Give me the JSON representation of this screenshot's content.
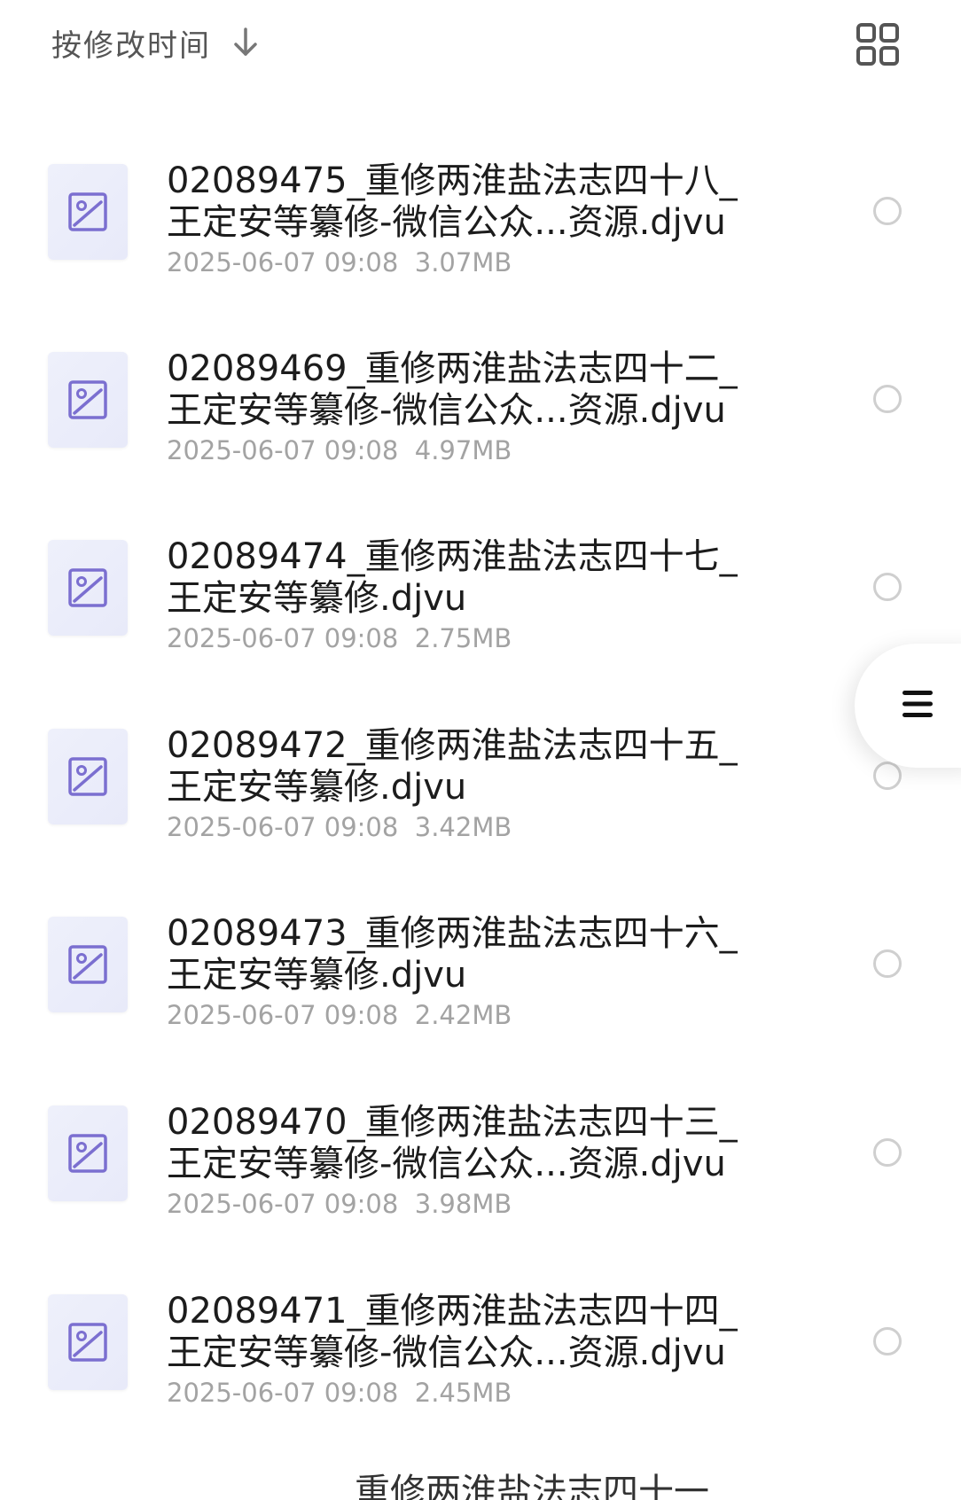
{
  "header": {
    "sort_label": "按修改时间",
    "sort_direction_icon": "arrow-down-icon",
    "view_toggle_icon": "grid-view-icon"
  },
  "files": [
    {
      "name": "02089475_重修两淮盐法志四十八_王定安等纂修-微信公众...资源.djvu",
      "date": "2025-06-07 09:08",
      "size": "3.07MB"
    },
    {
      "name": "02089469_重修两淮盐法志四十二_王定安等纂修-微信公众...资源.djvu",
      "date": "2025-06-07 09:08",
      "size": "4.97MB"
    },
    {
      "name": "02089474_重修两淮盐法志四十七_王定安等纂修.djvu",
      "date": "2025-06-07 09:08",
      "size": "2.75MB"
    },
    {
      "name": "02089472_重修两淮盐法志四十五_王定安等纂修.djvu",
      "date": "2025-06-07 09:08",
      "size": "3.42MB"
    },
    {
      "name": "02089473_重修两淮盐法志四十六_王定安等纂修.djvu",
      "date": "2025-06-07 09:08",
      "size": "2.42MB"
    },
    {
      "name": "02089470_重修两淮盐法志四十三_王定安等纂修-微信公众...资源.djvu",
      "date": "2025-06-07 09:08",
      "size": "3.98MB"
    },
    {
      "name": "02089471_重修两淮盐法志四十四_王定安等纂修-微信公众...资源.djvu",
      "date": "2025-06-07 09:08",
      "size": "2.45MB"
    }
  ],
  "partial_next": {
    "name": "重修两淮盐法志四十一"
  },
  "side_menu": {
    "icon": "menu-icon"
  },
  "colors": {
    "thumb_icon": "#7b6fd0",
    "text_primary": "#1c1c1c",
    "text_secondary": "#a3a3a3"
  }
}
